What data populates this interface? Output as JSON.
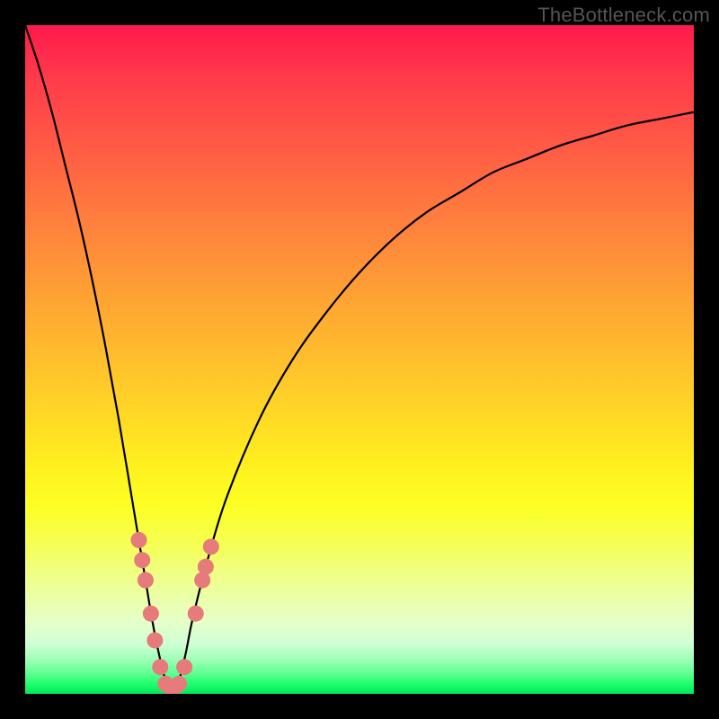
{
  "watermark": "TheBottleneck.com",
  "colors": {
    "frame": "#000000",
    "curve": "#000000",
    "marker": "#e77a7a",
    "gradient_top": "#ff1a4d",
    "gradient_bottom": "#00e85e"
  },
  "chart_data": {
    "type": "line",
    "title": "",
    "xlabel": "",
    "ylabel": "",
    "xlim": [
      0,
      100
    ],
    "ylim": [
      0,
      100
    ],
    "x": [
      0,
      2,
      4,
      6,
      8,
      10,
      12,
      14,
      16,
      18,
      19,
      20,
      21,
      22,
      23,
      24,
      25,
      27,
      30,
      35,
      40,
      45,
      50,
      55,
      60,
      65,
      70,
      75,
      80,
      85,
      90,
      95,
      100
    ],
    "y": [
      100,
      94,
      87,
      79,
      71,
      62,
      52,
      41,
      29,
      17,
      11,
      6,
      2,
      0,
      2,
      6,
      11,
      19,
      29,
      41,
      50,
      57,
      63,
      68,
      72,
      75,
      78,
      80,
      82,
      83.5,
      85,
      86,
      87
    ],
    "series": [
      {
        "name": "bottleneck-curve",
        "x_ref": "x",
        "y_ref": "y"
      }
    ],
    "markers": {
      "name": "highlighted-points",
      "points": [
        {
          "x": 17.0,
          "y": 23
        },
        {
          "x": 17.5,
          "y": 20
        },
        {
          "x": 18.0,
          "y": 17
        },
        {
          "x": 18.8,
          "y": 12
        },
        {
          "x": 19.4,
          "y": 8
        },
        {
          "x": 20.2,
          "y": 4
        },
        {
          "x": 21.0,
          "y": 1.5
        },
        {
          "x": 22.0,
          "y": 0.3
        },
        {
          "x": 23.0,
          "y": 1.5
        },
        {
          "x": 23.8,
          "y": 4
        },
        {
          "x": 25.5,
          "y": 12
        },
        {
          "x": 26.5,
          "y": 17
        },
        {
          "x": 27.0,
          "y": 19
        },
        {
          "x": 27.8,
          "y": 22
        }
      ]
    },
    "annotations": []
  }
}
